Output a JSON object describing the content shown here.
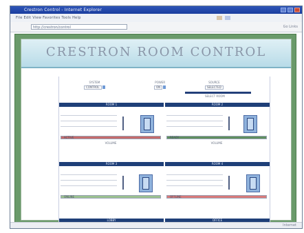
{
  "window": {
    "title": "Crestron Control - Internet Explorer",
    "accent": "#1a3d9e"
  },
  "menubar": {
    "text": "File  Edit  View  Favorites  Tools  Help"
  },
  "address": {
    "value": "http://crestron/control",
    "right_text": "Go   Links"
  },
  "page": {
    "title": "CRESTRON ROOM CONTROL",
    "top_controls": [
      {
        "label": "SYSTEM",
        "value": "CONTROL"
      },
      {
        "label": "POWER",
        "value": "ON"
      },
      {
        "label": "SOURCE",
        "value": "SELECTED"
      }
    ],
    "selected_caption": "SELECT ROOM",
    "rooms": [
      {
        "name": "ROOM 1",
        "status": "ACTIVE",
        "status_color": "#c66b6b",
        "sub": "VOLUME"
      },
      {
        "name": "ROOM 2",
        "status": "READY",
        "status_color": "#5f8f5f",
        "sub": "VOLUME"
      },
      {
        "name": "ROOM 3",
        "status": "ONLINE",
        "status_color": "#9bc28f",
        "sub": ""
      },
      {
        "name": "ROOM 4",
        "status": "OFFLINE",
        "status_color": "#d97a7a",
        "sub": ""
      }
    ],
    "bottom_bars": [
      "LOBBY",
      "OFFICE"
    ]
  },
  "statusbar": {
    "right": "Internet"
  }
}
